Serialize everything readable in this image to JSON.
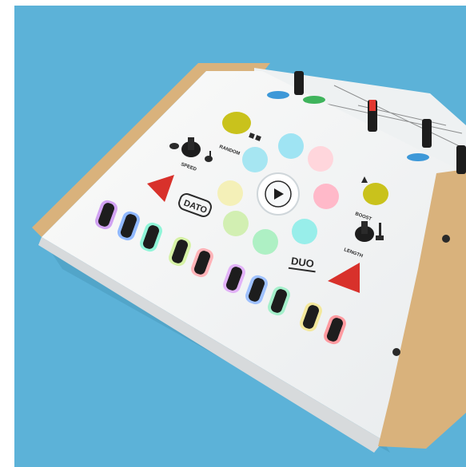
{
  "labels": {
    "random": "RANDOM",
    "speed": "SPEED",
    "boost": "BOOST",
    "length": "LENGTH",
    "brand": "DATO",
    "model": "DUO"
  },
  "colors": {
    "background": "#5cb2d8",
    "panel": "#f4f4f2",
    "wood": "#d9b27c",
    "yellow_button": "#c9c21c",
    "red_triangle": "#d8312b"
  },
  "icons": [
    "dice-icon",
    "rabbit-icon",
    "turtle-icon",
    "play-icon",
    "rocket-icon",
    "giraffe-icon"
  ]
}
